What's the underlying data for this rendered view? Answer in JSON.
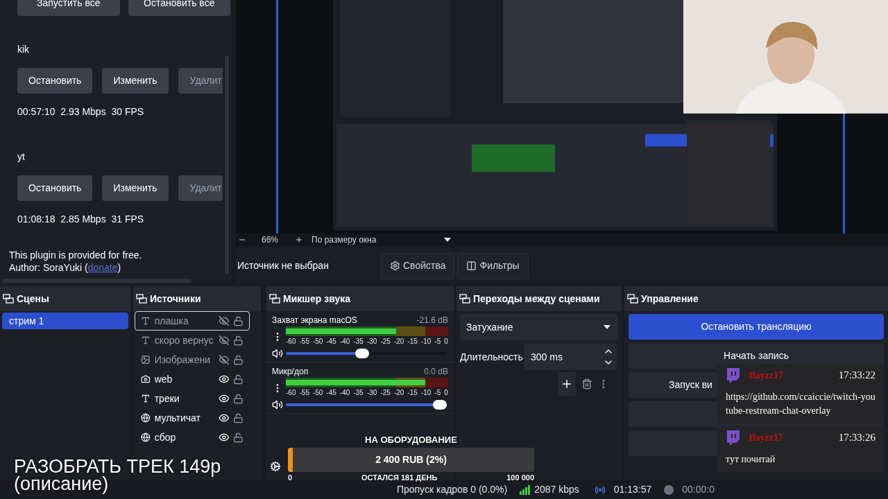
{
  "plugin_panel": {
    "top_buttons": [
      "Запустить все",
      "Остановить все"
    ],
    "targets": [
      {
        "name": "kik",
        "buttons": [
          {
            "label": "Остановить",
            "disabled": false
          },
          {
            "label": "Изменить",
            "disabled": false
          },
          {
            "label": "Удалит",
            "disabled": true
          }
        ],
        "stats": "00:57:10  2.93 Mbps  30 FPS"
      },
      {
        "name": "yt",
        "buttons": [
          {
            "label": "Остановить",
            "disabled": false
          },
          {
            "label": "Изменить",
            "disabled": false
          },
          {
            "label": "Удалит",
            "disabled": true
          }
        ],
        "stats": "01:08:18  2.85 Mbps  31 FPS"
      }
    ],
    "footer": {
      "line1": "This plugin is provided for free.",
      "prefix": "Author: SoraYuki (",
      "link": "donate",
      "suffix": ")"
    }
  },
  "preview": {
    "kind": "picture"
  },
  "zoom_bar": {
    "zoom": "66%",
    "fit": "По размеру окна"
  },
  "source_toolbar": {
    "status": "Источник не выбран",
    "buttons": [
      "Свойства",
      "Фильтры"
    ]
  },
  "scenes": {
    "title": "Сцены",
    "items": [
      {
        "name": "стрим 1",
        "selected": true
      }
    ]
  },
  "sources": {
    "title": "Источники",
    "items": [
      {
        "name": "плашка",
        "kind": "text",
        "visible": false,
        "selected": true
      },
      {
        "name": "скоро вернус",
        "kind": "text",
        "visible": false,
        "selected": false
      },
      {
        "name": "Изображени",
        "visible": false,
        "selected": false
      },
      {
        "name": "web",
        "kind": "camera",
        "visible": true,
        "selected": false
      },
      {
        "name": "треки",
        "kind": "text",
        "visible": true,
        "selected": false
      },
      {
        "name": "мультичат",
        "kind": "browser",
        "visible": true,
        "selected": false
      },
      {
        "name": "сбор",
        "kind": "browser",
        "visible": true,
        "selected": false
      }
    ]
  },
  "mixer": {
    "title": "Микшер звука",
    "channels": [
      {
        "name": "Захват экрана macOS",
        "reading": "-21.6 dB",
        "meter": {
          "level": 0.68
        },
        "volume": {
          "level": 0.47
        },
        "scale": [
          "-60",
          "-55",
          "-50",
          "-45",
          "-40",
          "-35",
          "-30",
          "-25",
          "-20",
          "-15",
          "-10",
          "-5",
          "0"
        ]
      },
      {
        "name": "Микр/доп",
        "reading": "0.0 dB",
        "meter": {
          "level": 0.86
        },
        "volume": {
          "level": 1
        },
        "scale": [
          "-60",
          "-55",
          "-50",
          "-45",
          "-40",
          "-35",
          "-30",
          "-25",
          "-20",
          "-15",
          "-10",
          "-5",
          "0"
        ]
      }
    ]
  },
  "transitions": {
    "title": "Переходы между сценами",
    "type": "Затухание",
    "duration_label": "Длительность",
    "duration": "300 ms"
  },
  "controls": {
    "title": "Управление",
    "buttons": [
      {
        "kind": "label",
        "label": "Остановить трансляцию",
        "selected": true
      },
      {
        "kind": "label",
        "label": "Начать запись",
        "selected": false
      },
      {
        "kind": "label",
        "label": "Запуск ви",
        "selected": false
      },
      {
        "kind": "covered",
        "selected": false
      },
      {
        "kind": "covered",
        "selected": false
      }
    ]
  },
  "overlay_title": [
    "РАЗОБРАТЬ ТРЕК 149р",
    "(описание)"
  ],
  "donation": {
    "goal": "НА ОБОРУДОВАНИЕ",
    "amount": "2 400 RUB (2%)",
    "level": 0.02,
    "min": "0",
    "remaining": "ОСТАЛСЯ 181 ДЕНЬ",
    "max": "100 000"
  },
  "chat": [
    {
      "user": "flayzz17",
      "time": "17:33:22",
      "text": "https://github.com/ccaiccie/twitch-youtube-restream-chat-overlay"
    },
    {
      "user": "flayzz17",
      "time": "17:33:26",
      "text": "тут почитай"
    }
  ],
  "status_bar": {
    "dropped": "Пропуск кадров 0 (0.0%)",
    "bitrate": "2087 kbps",
    "stream_time": "01:13:57",
    "record_time": "00:00:0"
  }
}
